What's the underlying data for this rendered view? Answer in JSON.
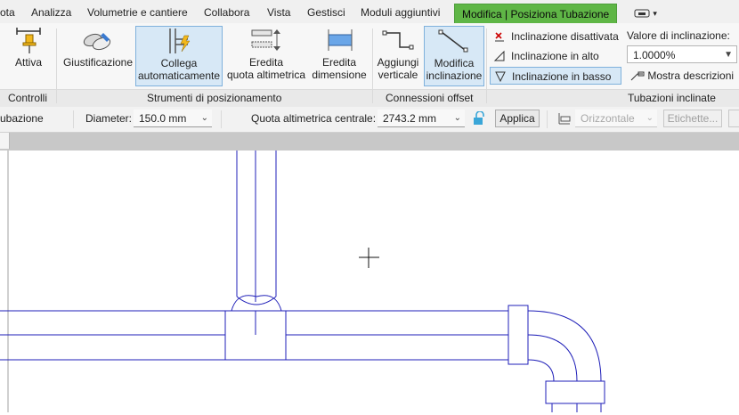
{
  "tabs": [
    {
      "label": "ota",
      "active": false
    },
    {
      "label": "Analizza",
      "active": false
    },
    {
      "label": "Volumetrie e cantiere",
      "active": false
    },
    {
      "label": "Collabora",
      "active": false
    },
    {
      "label": "Vista",
      "active": false
    },
    {
      "label": "Gestisci",
      "active": false
    },
    {
      "label": "Moduli aggiuntivi",
      "active": false
    },
    {
      "label": "Modifica | Posiziona Tubazione",
      "active": true
    }
  ],
  "tab_menu_glyph": "▾",
  "ribbon": {
    "controlli": {
      "title": "Controlli",
      "tool": "Attiva"
    },
    "strumenti": {
      "title": "Strumenti di posizionamento",
      "tools": [
        {
          "label": "Giustificazione"
        },
        {
          "label": "Collega automaticamente",
          "line1": "Collega",
          "line2": "automaticamente",
          "selected": true
        },
        {
          "label": "Eredita quota altimetrica",
          "line1": "Eredita",
          "line2": "quota altimetrica"
        },
        {
          "label": "Eredita dimensione",
          "line1": "Eredita",
          "line2": "dimensione"
        }
      ]
    },
    "connessioni": {
      "title": "Connessioni offset",
      "tools": [
        {
          "line1": "Aggiungi",
          "line2": "verticale"
        },
        {
          "line1": "Modifica",
          "line2": "inclinazione",
          "selected": true
        }
      ]
    },
    "tubazioni": {
      "title": "Tubazioni inclinate",
      "options": [
        {
          "label": "Inclinazione disattivata",
          "selected": false
        },
        {
          "label": "Inclinazione in alto",
          "selected": false
        },
        {
          "label": "Inclinazione in basso",
          "selected": true
        }
      ],
      "valore_label": "Valore di inclinazione:",
      "valore": "1.0000%",
      "mostra": "Mostra descrizioni"
    }
  },
  "options_bar": {
    "left_label": "ubazione",
    "diameter_label": "Diameter:",
    "diameter_value": "150.0 mm",
    "quota_label": "Quota altimetrica centrale:",
    "quota_value": "2743.2 mm",
    "applica": "Applica",
    "orizzontale": "Orizzontale",
    "etichette": "Etichette..."
  },
  "colors": {
    "accent": "#5fb646",
    "pipe_line": "#1f1fb8",
    "selected": "#d7e8f6"
  }
}
